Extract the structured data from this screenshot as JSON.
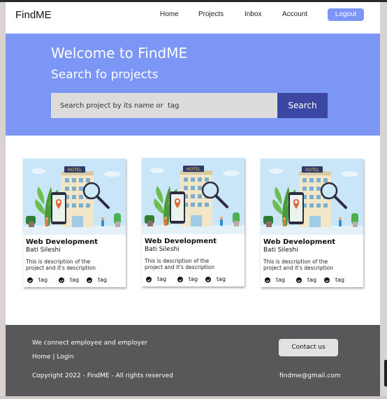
{
  "navbar": {
    "brand": "FindME",
    "links": [
      "Home",
      "Projects",
      "Inbox",
      "Account"
    ],
    "logout_label": "Logout"
  },
  "hero": {
    "title": "Welcome to FindME",
    "subtitle": "Search fo projects",
    "search_placeholder": "Search project by its name or  tag",
    "search_button": "Search"
  },
  "cards": [
    {
      "image_sign": "HOTEL",
      "title": "Web Development",
      "author": "Bati  Sileshi",
      "description": "This is description of the project and it's description",
      "tags": [
        "tag",
        "tag",
        "tag"
      ]
    },
    {
      "image_sign": "HOTEL",
      "title": "Web Development",
      "author": "Bati  Sileshi",
      "description": "This is description of the project and it's description",
      "tags": [
        "tag",
        "tag",
        "tag"
      ]
    },
    {
      "image_sign": "HOTEL",
      "title": "Web Development",
      "author": "Bati  Sileshi",
      "description": "This is description of the project and it's description",
      "tags": [
        "tag",
        "tag",
        "tag"
      ]
    }
  ],
  "footer": {
    "tagline": "We connect employee and employer",
    "home_link": "Home",
    "separator": " | ",
    "login_link": "Login",
    "copyright": "Copyright 2022 - FindME - All rights reserved",
    "contact_button": "Contact us",
    "email": "findme@gmail.com"
  },
  "colors": {
    "hero_bg": "#7b96f5",
    "search_button_bg": "#3c47a3",
    "logout_bg": "#7b96f5",
    "footer_bg": "#58585a"
  }
}
